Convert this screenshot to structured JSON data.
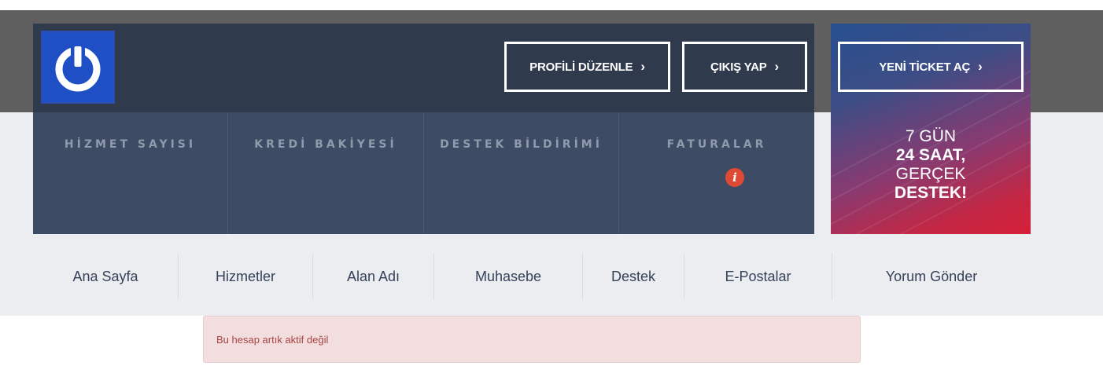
{
  "header": {
    "buttons": {
      "edit_profile": "PROFİLİ DÜZENLE",
      "logout": "ÇIKIŞ YAP",
      "new_ticket": "YENİ TİCKET AÇ"
    },
    "chevron": "›"
  },
  "stats": [
    {
      "label": "HİZMET SAYISI"
    },
    {
      "label": "KREDİ BAKİYESİ"
    },
    {
      "label": "DESTEK BİLDİRİMİ"
    },
    {
      "label": "FATURALAR",
      "badge": "i"
    }
  ],
  "promo": {
    "line1": "7 GÜN",
    "line2": "24 SAAT,",
    "line3": "GERÇEK",
    "line4": "DESTEK!"
  },
  "nav": {
    "items": [
      "Ana Sayfa",
      "Hizmetler",
      "Alan Adı",
      "Muhasebe",
      "Destek",
      "E-Postalar",
      "Yorum Gönder"
    ]
  },
  "alert": {
    "message": "Bu hesap artık aktif değil"
  },
  "colors": {
    "accent_blue": "#1f4fc4",
    "panel_dark": "#2f3a4d",
    "panel_stats": "#3d4b65",
    "alert_bg": "#f2dede",
    "alert_text": "#a94442"
  },
  "icons": {
    "logo": "power-icon",
    "chevron": "chevron-right-icon",
    "info": "info-icon"
  }
}
